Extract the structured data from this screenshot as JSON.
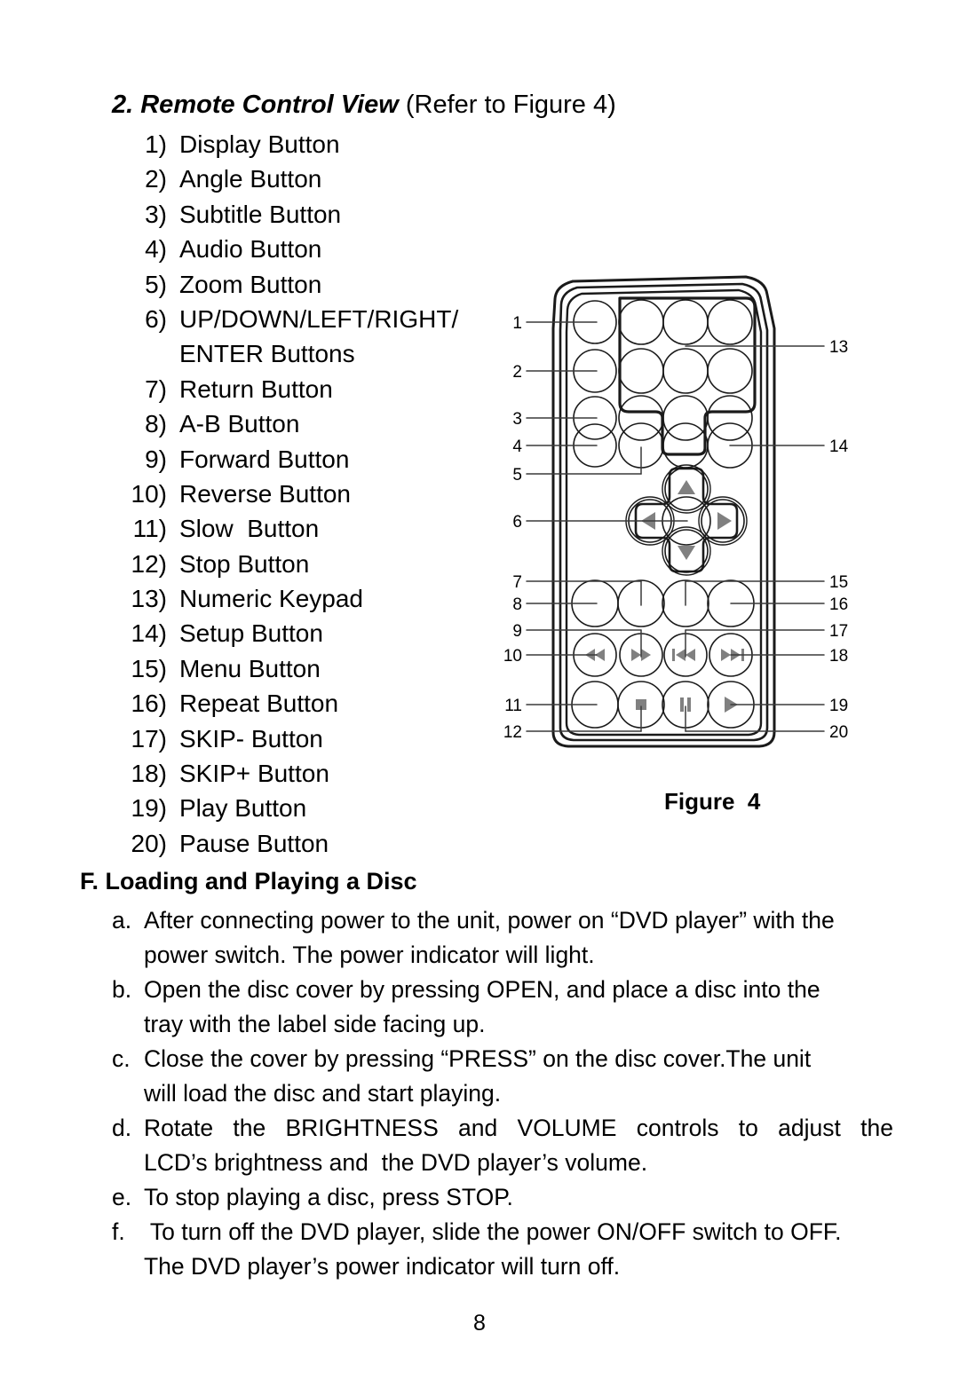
{
  "document": {
    "page_number": "8"
  },
  "section": {
    "heading_emphasis": "2. Remote Control View",
    "heading_rest": " (Refer to Figure 4)",
    "items": [
      {
        "index": "1)",
        "label": "Display Button"
      },
      {
        "index": "2)",
        "label": "Angle Button"
      },
      {
        "index": "3)",
        "label": "Subtitle Button"
      },
      {
        "index": "4)",
        "label": "Audio Button"
      },
      {
        "index": "5)",
        "label": "Zoom Button"
      },
      {
        "index": "6)",
        "label": "UP/DOWN/LEFT/RIGHT/"
      },
      {
        "index": "",
        "label": "ENTER Buttons",
        "continuation": true
      },
      {
        "index": "7)",
        "label": "Return Button"
      },
      {
        "index": "8)",
        "label": "A-B Button"
      },
      {
        "index": "9)",
        "label": "Forward Button"
      },
      {
        "index": "10)",
        "label": "Reverse Button"
      },
      {
        "index": "11)",
        "label": "Slow  Button"
      },
      {
        "index": "12)",
        "label": "Stop Button"
      },
      {
        "index": "13)",
        "label": "Numeric Keypad"
      },
      {
        "index": "14)",
        "label": "Setup Button"
      },
      {
        "index": "15)",
        "label": "Menu Button"
      },
      {
        "index": "16)",
        "label": "Repeat Button"
      },
      {
        "index": "17)",
        "label": "SKIP- Button"
      },
      {
        "index": "18)",
        "label": "SKIP+ Button"
      },
      {
        "index": "19)",
        "label": "Play Button"
      },
      {
        "index": "20)",
        "label": "Pause Button"
      }
    ]
  },
  "figure": {
    "caption": "Figure  4",
    "callouts_left": [
      "1",
      "2",
      "3",
      "4",
      "5",
      "6",
      "7",
      "8",
      "9",
      "10",
      "11",
      "12"
    ],
    "callouts_right": [
      "13",
      "14",
      "15",
      "16",
      "17",
      "18",
      "19",
      "20"
    ],
    "button_icons": [
      "rewind-icon",
      "fast-forward-icon",
      "skip-previous-icon",
      "skip-next-icon",
      "stop-icon",
      "pause-icon",
      "play-icon",
      "dpad-up-icon",
      "dpad-down-icon",
      "dpad-left-icon",
      "dpad-right-icon"
    ],
    "colors": {
      "outline": "#1a1a1a",
      "icon_fill": "#808080"
    }
  },
  "subsection": {
    "heading": "F. Loading and Playing a Disc",
    "items": [
      {
        "letter": "a.",
        "lines": [
          "After connecting power to the unit, power on “DVD player” with the",
          "power switch. The power indicator will light."
        ]
      },
      {
        "letter": "b.",
        "lines": [
          "Open the disc cover by pressing OPEN, and place a disc into the",
          "tray with the label side facing up."
        ]
      },
      {
        "letter": "c.",
        "lines": [
          "Close the cover by pressing “PRESS” on the disc cover.The unit",
          "will load the disc and start playing."
        ]
      },
      {
        "letter": "d.",
        "lines": [
          "Rotate the BRIGHTNESS and VOLUME controls to adjust  the",
          "LCD’s brightness and  the DVD player’s volume."
        ],
        "justify_first": true
      },
      {
        "letter": "e.",
        "lines": [
          "To stop playing a disc, press STOP."
        ]
      },
      {
        "letter": "f.",
        "lines": [
          " To turn off the DVD player, slide the power ON/OFF switch to OFF.",
          "The DVD player’s power indicator will turn off."
        ]
      }
    ]
  }
}
